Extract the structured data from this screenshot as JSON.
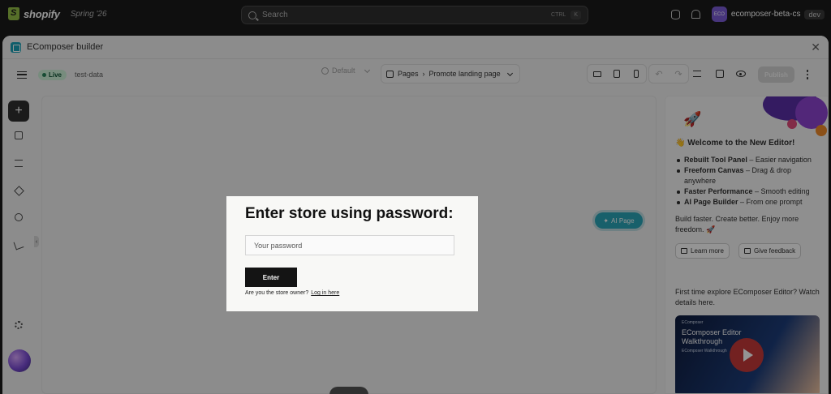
{
  "topbar": {
    "brand": "shopify",
    "edition": "Spring '26",
    "search_placeholder": "Search",
    "shortcut_ctrl": "CTRL",
    "shortcut_key": "K",
    "store_initials": "ECO",
    "store_name": "ecomposer-beta-cs",
    "env_badge": "dev"
  },
  "frame": {
    "title": "EComposer builder",
    "close_icon": "close-icon"
  },
  "toolbar": {
    "status": "Live",
    "status_color": "#29845a",
    "data_label": "test-data",
    "theme_value": "Default",
    "pages_label": "Pages",
    "page_name": "Promote landing page",
    "publish_label": "Publish"
  },
  "canvas": {
    "ai_button_label": "AI Page",
    "accent": "#2aa5b8"
  },
  "panel": {
    "welcome_emoji": "👋",
    "welcome_title": "Welcome to the New Editor!",
    "features": [
      {
        "bold": "Rebuilt Tool Panel",
        "text": " – Easier navigation"
      },
      {
        "bold": "Freeform Canvas",
        "text": " – Drag & drop anywhere"
      },
      {
        "bold": "Faster Performance",
        "text": " – Smooth editing"
      },
      {
        "bold": "AI Page Builder",
        "text": " – From one prompt"
      }
    ],
    "tagline": "Build faster. Create better. Enjoy more freedom. 🚀",
    "learn_more": "Learn more",
    "give_feedback": "Give feedback",
    "explore_text": "First time explore EComposer Editor? Watch details here.",
    "video_brand": "EComposer",
    "video_title": "EComposer Editor Walkthrough",
    "video_subtitle": "EComposer Walkthrough"
  },
  "password_popup": {
    "title": "Enter store using password:",
    "input_placeholder": "Your password",
    "enter_label": "Enter",
    "owner_text": "Are you the store owner?",
    "login_link": "Log in here"
  }
}
